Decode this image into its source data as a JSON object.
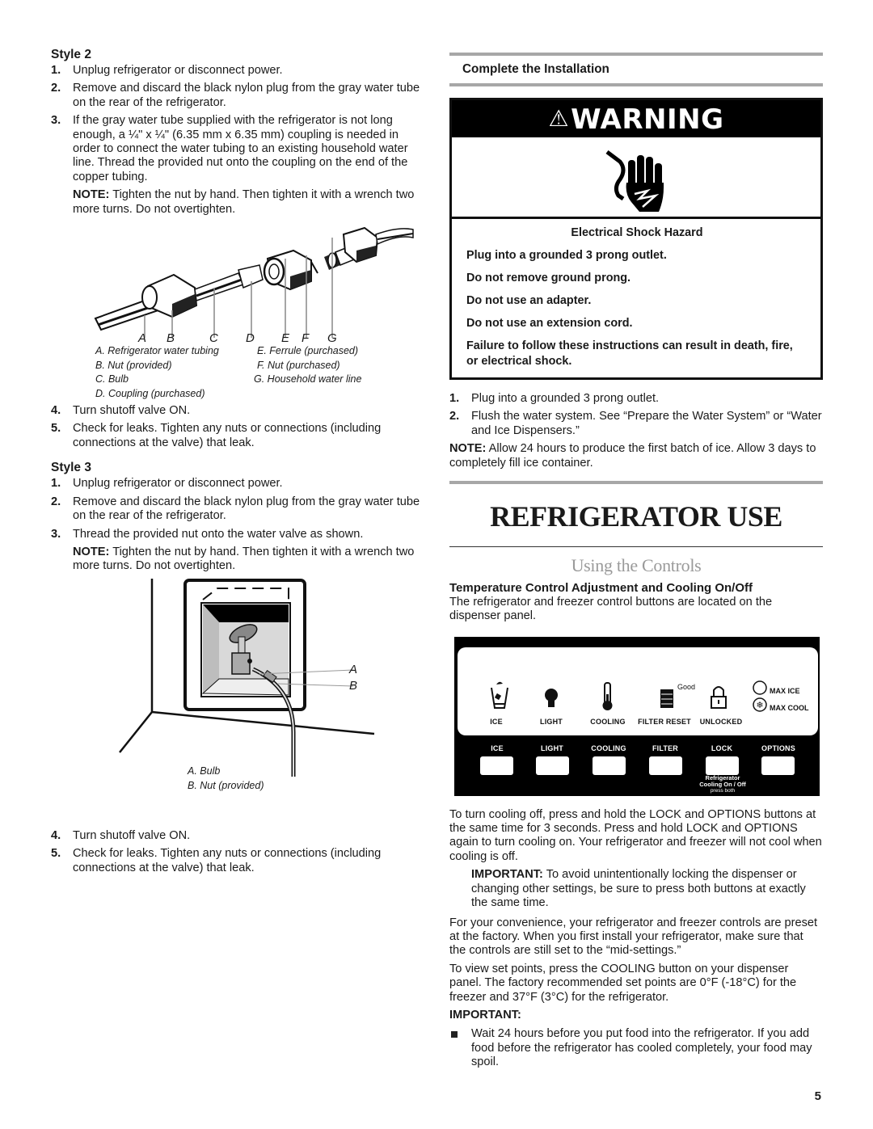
{
  "left": {
    "style2": {
      "heading": "Style 2",
      "steps": [
        {
          "num": "1.",
          "text": "Unplug refrigerator or disconnect power."
        },
        {
          "num": "2.",
          "text": "Remove and discard the black nylon plug from the gray water tube on the rear of the refrigerator."
        },
        {
          "num": "3.",
          "text": "If the gray water tube supplied with the refrigerator is not long enough, a ¼\" x ¼\" (6.35 mm x 6.35 mm) coupling is needed in order to connect the water tubing to an existing household water line. Thread the provided nut onto the coupling on the end of the copper tubing."
        }
      ],
      "note_label": "NOTE:",
      "note_text": " Tighten the nut by hand. Then tighten it with a wrench two more turns. Do not overtighten.",
      "figure": {
        "letters": [
          "A",
          "B",
          "C",
          "D",
          "E",
          "F",
          "G"
        ],
        "captions": [
          "A. Refrigerator water tubing",
          "B. Nut (provided)",
          "C. Bulb",
          "D. Coupling (purchased)",
          "E. Ferrule (purchased)",
          "F. Nut (purchased)",
          "G. Household water line"
        ]
      },
      "steps_after": [
        {
          "num": "4.",
          "text": "Turn shutoff valve ON."
        },
        {
          "num": "5.",
          "text": "Check for leaks. Tighten any nuts or connections (including connections at the valve) that leak."
        }
      ]
    },
    "style3": {
      "heading": "Style 3",
      "steps": [
        {
          "num": "1.",
          "text": "Unplug refrigerator or disconnect power."
        },
        {
          "num": "2.",
          "text": "Remove and discard the black nylon plug from the gray water tube on the rear of the refrigerator."
        },
        {
          "num": "3.",
          "text": "Thread the provided nut onto the water valve as shown."
        }
      ],
      "note_label": "NOTE:",
      "note_text": " Tighten the nut by hand. Then tighten it with a wrench two more turns. Do not overtighten.",
      "figure": {
        "letters": [
          "A",
          "B"
        ],
        "captions": [
          "A. Bulb",
          "B. Nut (provided)"
        ]
      },
      "steps_after": [
        {
          "num": "4.",
          "text": "Turn shutoff valve ON."
        },
        {
          "num": "5.",
          "text": "Check for leaks. Tighten any nuts or connections (including connections at the valve) that leak."
        }
      ]
    }
  },
  "right": {
    "complete_heading": "Complete the Installation",
    "warning": {
      "title": "WARNING",
      "icon": "electrical-shock-hand-icon",
      "hazard": "Electrical Shock Hazard",
      "lines": [
        "Plug into a grounded 3 prong outlet.",
        "Do not remove ground prong.",
        "Do not use an adapter.",
        "Do not use an extension cord.",
        "Failure to follow these instructions can result in death, fire, or electrical shock."
      ]
    },
    "steps": [
      {
        "num": "1.",
        "text": "Plug into a grounded 3 prong outlet."
      },
      {
        "num": "2.",
        "text": "Flush the water system. See “Prepare the Water System” or “Water and Ice Dispensers.”"
      }
    ],
    "note_label": "NOTE:",
    "note_text": " Allow 24 hours to produce the first batch of ice. Allow 3 days to completely fill ice container.",
    "main_title": "REFRIGERATOR USE",
    "section_title": "Using the Controls",
    "sub_heading": "Temperature Control Adjustment and Cooling On/Off",
    "sub_intro": "The refrigerator and freezer control buttons are located on the dispenser panel.",
    "panel": {
      "icon_labels": [
        "ICE",
        "LIGHT",
        "COOLING",
        "FILTER RESET",
        "UNLOCKED"
      ],
      "filter_status": "Good",
      "options": [
        "MAX ICE",
        "MAX COOL"
      ],
      "button_labels": [
        "ICE",
        "LIGHT",
        "COOLING",
        "FILTER",
        "LOCK",
        "OPTIONS"
      ],
      "both_line1": "Refrigerator",
      "both_line2": "Cooling On / Off",
      "both_line3": "press both"
    },
    "para1": "To turn cooling off, press and hold the LOCK and OPTIONS buttons at the same time for 3 seconds. Press and hold LOCK and OPTIONS again to turn cooling on. Your refrigerator and freezer will not cool when cooling is off.",
    "important1_label": "IMPORTANT:",
    "important1_text": " To avoid unintentionally locking the dispenser or changing other settings, be sure to press both buttons at exactly the same time.",
    "para2": "For your convenience, your refrigerator and freezer controls are preset at the factory. When you first install your refrigerator, make sure that the controls are still set to the “mid-settings.”",
    "para3": "To view set points, press the COOLING button on your dispenser panel. The factory recommended set points are 0°F (-18°C) for the freezer and 37°F (3°C) for the refrigerator.",
    "important2_label": "IMPORTANT:",
    "bullets": [
      "Wait 24 hours before you put food into the refrigerator. If you add food before the refrigerator has cooled completely, your food may spoil."
    ]
  },
  "page_number": "5"
}
